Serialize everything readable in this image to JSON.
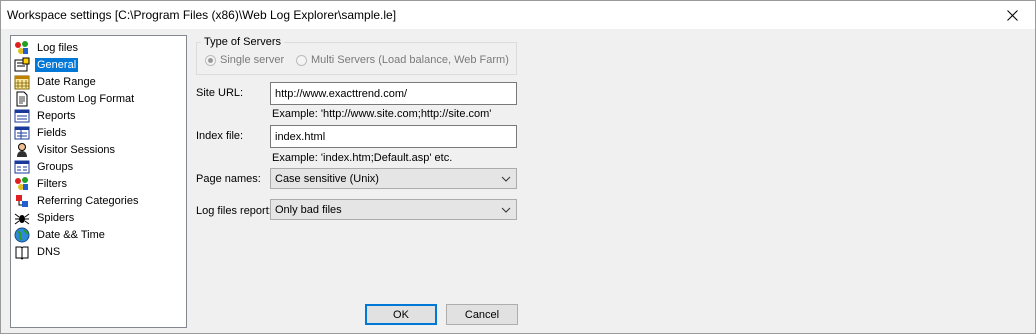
{
  "window": {
    "title": "Workspace settings [C:\\Program Files (x86)\\Web Log Explorer\\sample.le]"
  },
  "tree": {
    "items": [
      {
        "label": "Log files",
        "icon": "log-files-icon"
      },
      {
        "label": "General",
        "icon": "general-icon",
        "selected": true
      },
      {
        "label": "Date Range",
        "icon": "calendar-icon"
      },
      {
        "label": "Custom Log Format",
        "icon": "document-icon"
      },
      {
        "label": "Reports",
        "icon": "reports-icon"
      },
      {
        "label": "Fields",
        "icon": "fields-icon"
      },
      {
        "label": "Visitor Sessions",
        "icon": "visitor-icon"
      },
      {
        "label": "Groups",
        "icon": "groups-icon"
      },
      {
        "label": "Filters",
        "icon": "filters-icon"
      },
      {
        "label": "Referring Categories",
        "icon": "referring-icon"
      },
      {
        "label": "Spiders",
        "icon": "spider-icon"
      },
      {
        "label": "Date && Time",
        "icon": "globe-icon"
      },
      {
        "label": "DNS",
        "icon": "book-icon"
      }
    ]
  },
  "servers": {
    "group_title": "Type of Servers",
    "single_label": "Single server",
    "multi_label": "Multi Servers (Load balance, Web Farm)",
    "selected": "single"
  },
  "site_url": {
    "label": "Site URL:",
    "value": "http://www.exacttrend.com/",
    "hint": "Example: 'http://www.site.com;http://site.com'"
  },
  "index_file": {
    "label": "Index file:",
    "value": "index.html",
    "hint": "Example: 'index.htm;Default.asp' etc."
  },
  "page_names": {
    "label": "Page names:",
    "value": "Case sensitive (Unix)"
  },
  "log_report": {
    "label": "Log files report:",
    "value": "Only bad files"
  },
  "buttons": {
    "ok": "OK",
    "cancel": "Cancel"
  },
  "colors": {
    "selection": "#0078d7",
    "window_bg": "#f0f0f0"
  }
}
